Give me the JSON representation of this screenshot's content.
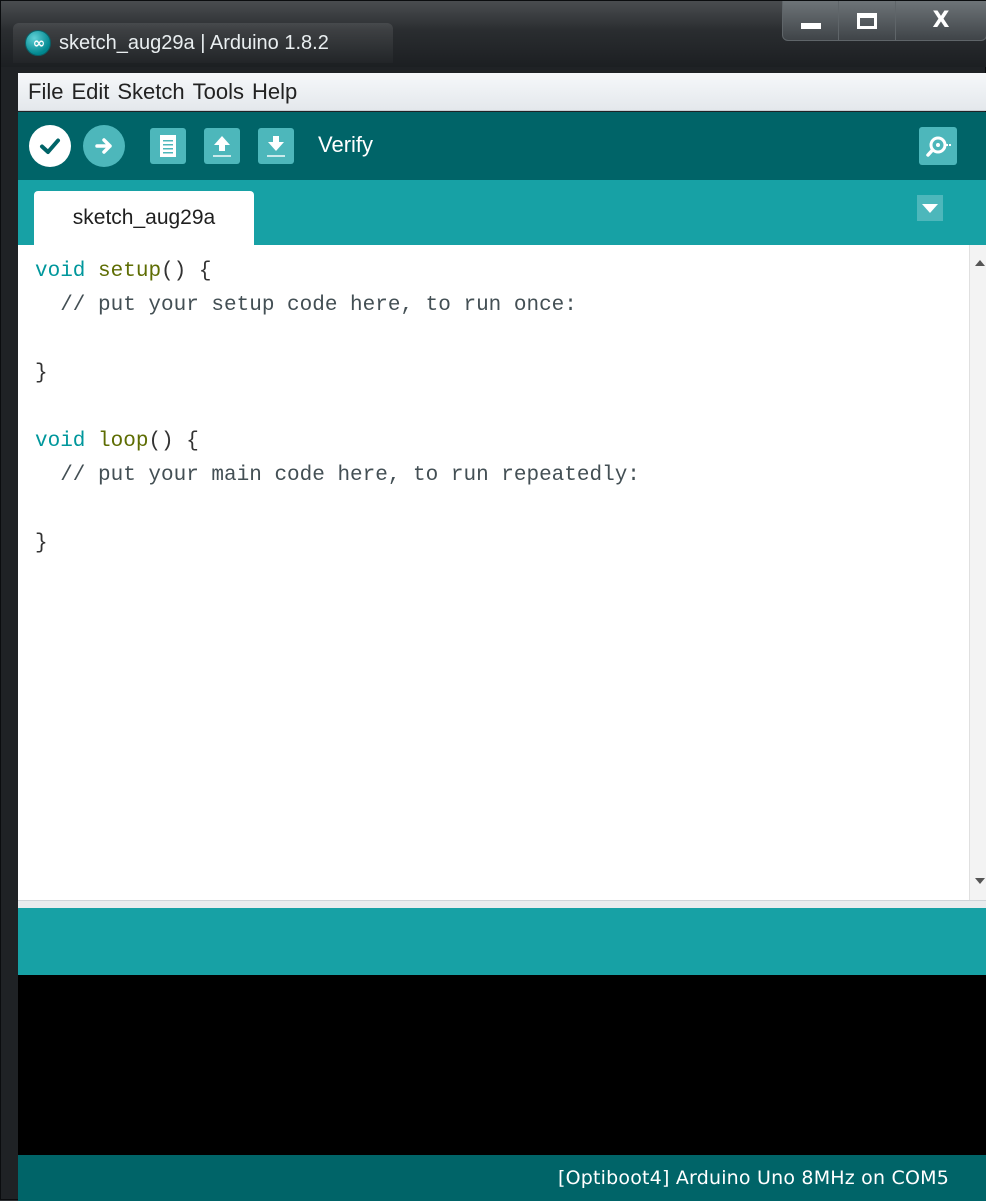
{
  "window": {
    "title": "sketch_aug29a | Arduino 1.8.2",
    "app_icon_glyph": "∞",
    "close_glyph": "X"
  },
  "menu": [
    {
      "label": "File"
    },
    {
      "label": "Edit"
    },
    {
      "label": "Sketch"
    },
    {
      "label": "Tools"
    },
    {
      "label": "Help"
    }
  ],
  "toolbar": {
    "hover_label": "Verify",
    "buttons": [
      {
        "name": "verify",
        "icon": "check-icon"
      },
      {
        "name": "upload",
        "icon": "arrow-right-icon"
      },
      {
        "name": "new",
        "icon": "document-icon"
      },
      {
        "name": "open",
        "icon": "arrow-up-icon"
      },
      {
        "name": "save",
        "icon": "arrow-down-icon"
      },
      {
        "name": "serial-monitor",
        "icon": "magnifier-icon"
      }
    ]
  },
  "tabs": [
    {
      "label": "sketch_aug29a",
      "active": true
    }
  ],
  "editor": {
    "lines": [
      "void setup() {",
      "  // put your setup code here, to run once:",
      "",
      "}",
      "",
      "void loop() {",
      "  // put your main code here, to run repeatedly:",
      "",
      "}"
    ]
  },
  "status": {
    "board_text": "[Optiboot4] Arduino Uno 8MHz on COM5"
  },
  "colors": {
    "toolbar": "#006468",
    "tabstrip": "#17a1a5",
    "button_fill": "#4db7bb",
    "keyword_type": "#00979c",
    "keyword_function": "#5e6d03",
    "console_bg": "#000000"
  }
}
